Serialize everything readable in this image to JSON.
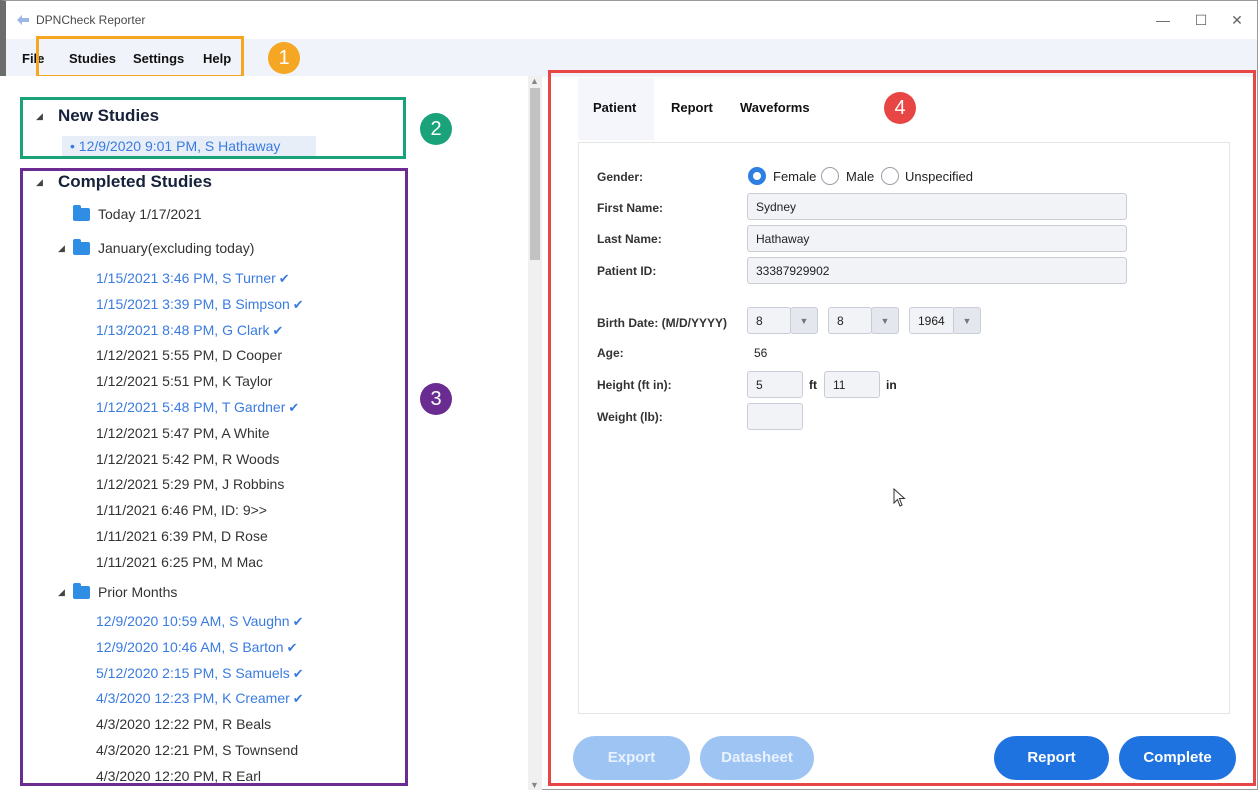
{
  "window": {
    "title": "DPNCheck Reporter",
    "controls": {
      "minimize": "—",
      "maximize": "☐",
      "close": "✕"
    }
  },
  "menu": {
    "items": [
      "File",
      "Studies",
      "Settings",
      "Help"
    ]
  },
  "callouts": [
    "1",
    "2",
    "3",
    "4"
  ],
  "callout_colors": {
    "menu": "#f5a623",
    "new_studies": "#1aa37a",
    "completed": "#6b2c91",
    "detail": "#e84545"
  },
  "tree": {
    "new_studies_heading": "New Studies",
    "new_studies": [
      "• 12/9/2020 9:01 PM, S Hathaway"
    ],
    "completed_heading": "Completed Studies",
    "today_folder": "Today 1/17/2021",
    "january_folder": "January(excluding today)",
    "january_studies": [
      {
        "label": "1/15/2021 3:46 PM, S Turner",
        "done": true
      },
      {
        "label": "1/15/2021 3:39 PM, B Simpson",
        "done": true
      },
      {
        "label": "1/13/2021 8:48 PM, G Clark",
        "done": true
      },
      {
        "label": "1/12/2021 5:55 PM, D Cooper",
        "done": false
      },
      {
        "label": "1/12/2021 5:51 PM, K Taylor",
        "done": false
      },
      {
        "label": "1/12/2021 5:48 PM, T Gardner",
        "done": true
      },
      {
        "label": "1/12/2021 5:47 PM, A White",
        "done": false
      },
      {
        "label": "1/12/2021 5:42 PM, R Woods",
        "done": false
      },
      {
        "label": "1/12/2021 5:29 PM, J Robbins",
        "done": false
      },
      {
        "label": "1/11/2021 6:46 PM, ID: 9>>",
        "done": false
      },
      {
        "label": "1/11/2021 6:39 PM, D Rose",
        "done": false
      },
      {
        "label": "1/11/2021 6:25 PM, M Mac",
        "done": false
      }
    ],
    "prior_folder": "Prior Months",
    "prior_studies": [
      {
        "label": "12/9/2020 10:59 AM, S Vaughn",
        "done": true
      },
      {
        "label": "12/9/2020 10:46 AM, S Barton",
        "done": true
      },
      {
        "label": "5/12/2020 2:15 PM, S Samuels",
        "done": true
      },
      {
        "label": "4/3/2020 12:23 PM, K Creamer",
        "done": true
      },
      {
        "label": "4/3/2020 12:22 PM, R Beals",
        "done": false
      },
      {
        "label": "4/3/2020 12:21 PM, S Townsend",
        "done": false
      },
      {
        "label": "4/3/2020 12:20 PM, R Earl",
        "done": false
      }
    ],
    "check_glyph": "✔"
  },
  "tabs": [
    "Patient",
    "Report",
    "Waveforms"
  ],
  "patient_form": {
    "gender_label": "Gender:",
    "gender_options": [
      "Female",
      "Male",
      "Unspecified"
    ],
    "gender_selected": "Female",
    "first_name_label": "First Name:",
    "first_name": "Sydney",
    "last_name_label": "Last Name:",
    "last_name": "Hathaway",
    "patient_id_label": "Patient ID:",
    "patient_id": "33387929902",
    "birth_date_label": "Birth Date: (M/D/YYYY)",
    "birth_month": "8",
    "birth_day": "8",
    "birth_year": "1964",
    "age_label": "Age:",
    "age": "56",
    "height_label": "Height (ft in):",
    "height_ft": "5",
    "ft_unit": "ft",
    "height_in": "11",
    "in_unit": "in",
    "weight_label": "Weight (lb):",
    "weight": ""
  },
  "buttons": {
    "export": "Export",
    "datasheet": "Datasheet",
    "report": "Report",
    "complete": "Complete"
  }
}
